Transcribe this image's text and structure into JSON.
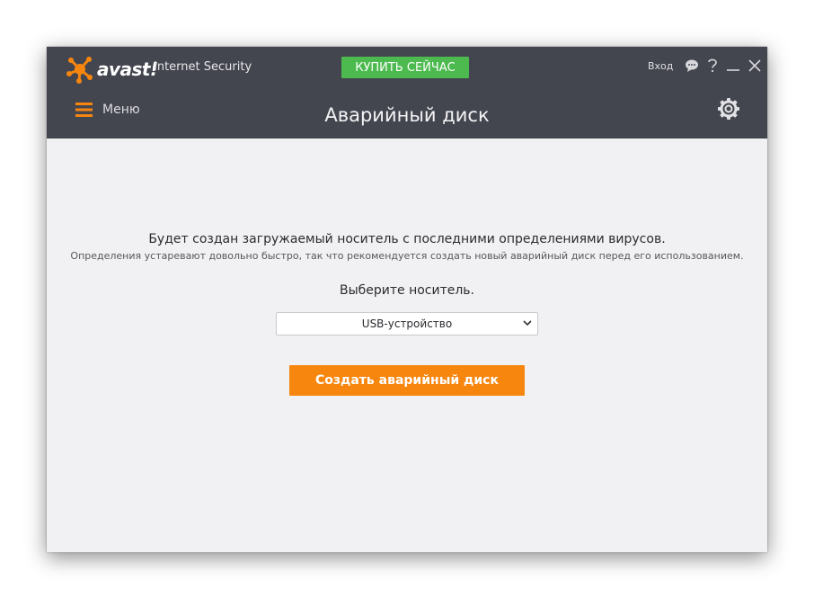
{
  "app": {
    "logo_text": "avast!",
    "product_name": "Internet Security",
    "buy_label": "КУПИТЬ СЕЙЧАС",
    "login_label": "Вход",
    "icons": [
      "chat-icon",
      "help-icon",
      "minimize-icon",
      "close-icon"
    ]
  },
  "nav": {
    "menu_label": "Меню",
    "title": "Аварийный диск",
    "settings_icon": "gear-icon"
  },
  "main": {
    "description": "Будет создан загружаемый носитель с последними определениями вирусов.",
    "note": "Определения устаревают довольно быстро, так что рекомендуется создать новый аварийный диск перед его использованием.",
    "choose_label": "Выберите носитель.",
    "media_select": {
      "selected": "USB-устройство"
    },
    "create_button": "Создать аварийный диск"
  },
  "colors": {
    "header_bg": "#44464f",
    "buy_green": "#4cba4f",
    "accent_orange": "#f7860f",
    "content_bg": "#f1f1f4"
  }
}
